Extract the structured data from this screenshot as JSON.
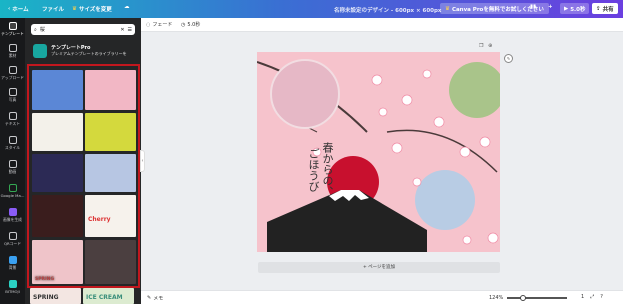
{
  "topbar": {
    "home": "ホーム",
    "file": "ファイル",
    "resize": "サイズを変更",
    "title": "名称未設定のデザイン - 600px × 600px",
    "pro_cta": "Canva Proを無料でお試しください",
    "play_label": "5.0秒",
    "share_label": "共有"
  },
  "rail": {
    "items": [
      {
        "label": "テンプレート",
        "icon": "template-icon"
      },
      {
        "label": "素材",
        "icon": "elements-icon"
      },
      {
        "label": "アップロード",
        "icon": "upload-icon"
      },
      {
        "label": "写真",
        "icon": "photo-icon"
      },
      {
        "label": "テキスト",
        "icon": "text-icon"
      },
      {
        "label": "スタイル",
        "icon": "style-icon"
      },
      {
        "label": "動画",
        "icon": "video-icon"
      },
      {
        "label": "Google Ma...",
        "icon": "maps-icon"
      },
      {
        "label": "画像を生成",
        "icon": "generate-icon"
      },
      {
        "label": "QRコード",
        "icon": "qr-icon"
      },
      {
        "label": "背景",
        "icon": "background-icon"
      },
      {
        "label": "BITMOJI",
        "icon": "bitmoji-icon"
      }
    ]
  },
  "panel": {
    "search_value": "桜",
    "pro_title": "テンプレートPro",
    "pro_desc": "プレミアムテンプレートのライブラリーを",
    "thumbs": [
      {
        "title": "",
        "color": "#5b87d6"
      },
      {
        "title": "",
        "color": "#f2b7c5"
      },
      {
        "title": "",
        "color": "#f3f1ea"
      },
      {
        "title": "",
        "color": "#d4d93d"
      },
      {
        "title": "",
        "color": "#2c2a55"
      },
      {
        "title": "",
        "color": "#b7c6e3"
      },
      {
        "title": "",
        "color": "#3a1d1d"
      },
      {
        "title": "Cherry",
        "color": "#f6f2ec"
      },
      {
        "title": "SPRING",
        "color": "#efc4c9"
      },
      {
        "title": "",
        "color": "#4b3f40"
      },
      {
        "title": "SPRING",
        "color": "#f3e6e2"
      },
      {
        "title": "ICE CREAM",
        "color": "#dcebd0"
      }
    ]
  },
  "toolbar2": {
    "font_label": "フェード",
    "timer_label": "5.0秒"
  },
  "canvas": {
    "bg_color": "#f6c3cc",
    "text_line1": "春からの、",
    "text_line2": "ごほうび"
  },
  "add_page_label": "+ ページを追加",
  "bottom": {
    "notes_label": "メモ",
    "zoom_label": "124%",
    "zoom_value": 124,
    "page_count": "1"
  }
}
